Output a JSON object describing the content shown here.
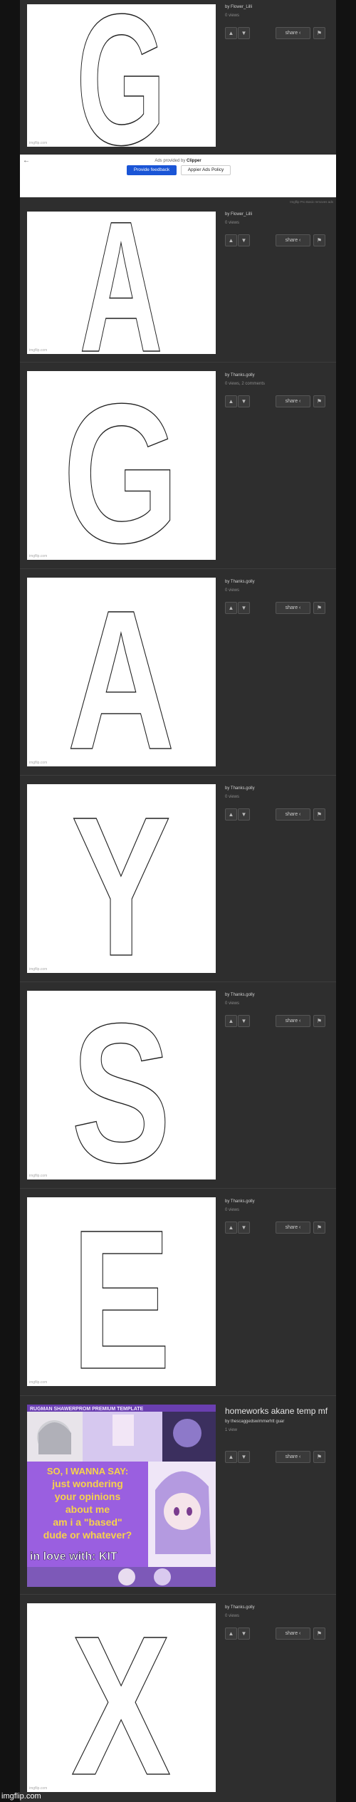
{
  "footer_watermark": "imgflip.com",
  "image_watermark": "imgflip.com",
  "labels": {
    "share": "share",
    "by_prefix": "by"
  },
  "ad": {
    "provided_by_prefix": "Ads provided by",
    "provider": "Clipper",
    "buttons": {
      "feedback": "Provide feedback",
      "policy": "Appier Ads Policy"
    },
    "footer_note": "Imgflip Pro Basic removes ads"
  },
  "posts": [
    {
      "letter": "G",
      "user": "Flower_Lilli",
      "stats": "0 views"
    },
    {
      "letter": "A",
      "user": "Flower_Lilli",
      "stats": "0 views"
    },
    {
      "letter": "G",
      "user": "Thanks.golly",
      "stats": "0 views, 2 comments"
    },
    {
      "letter": "A",
      "user": "Thanks.golly",
      "stats": "0 views"
    },
    {
      "letter": "Y",
      "user": "Thanks.golly",
      "stats": "0 views"
    },
    {
      "letter": "S",
      "user": "Thanks.golly",
      "stats": "0 views"
    },
    {
      "letter": "E",
      "user": "Thanks.golly",
      "stats": "0 views"
    },
    {
      "title": "homeworks akane temp mf",
      "user": "thescaggedswimmerhtt guar",
      "stats": "1 view",
      "meme": {
        "header": "RUGMAN SHAWERPROM PREMIUM TEMPLATE",
        "lines": [
          "SO, I WANNA SAY:",
          "just wondering",
          "your opinions",
          "about me",
          "am i a \"based\"",
          "dude or whatever?"
        ],
        "bottom": "in love with: KIT"
      }
    },
    {
      "letter": "X",
      "user": "Thanks.golly",
      "stats": "0 views"
    }
  ],
  "colors": {
    "page": "#121212",
    "column": "#2e2e2e",
    "accent": "#1a55d6"
  }
}
